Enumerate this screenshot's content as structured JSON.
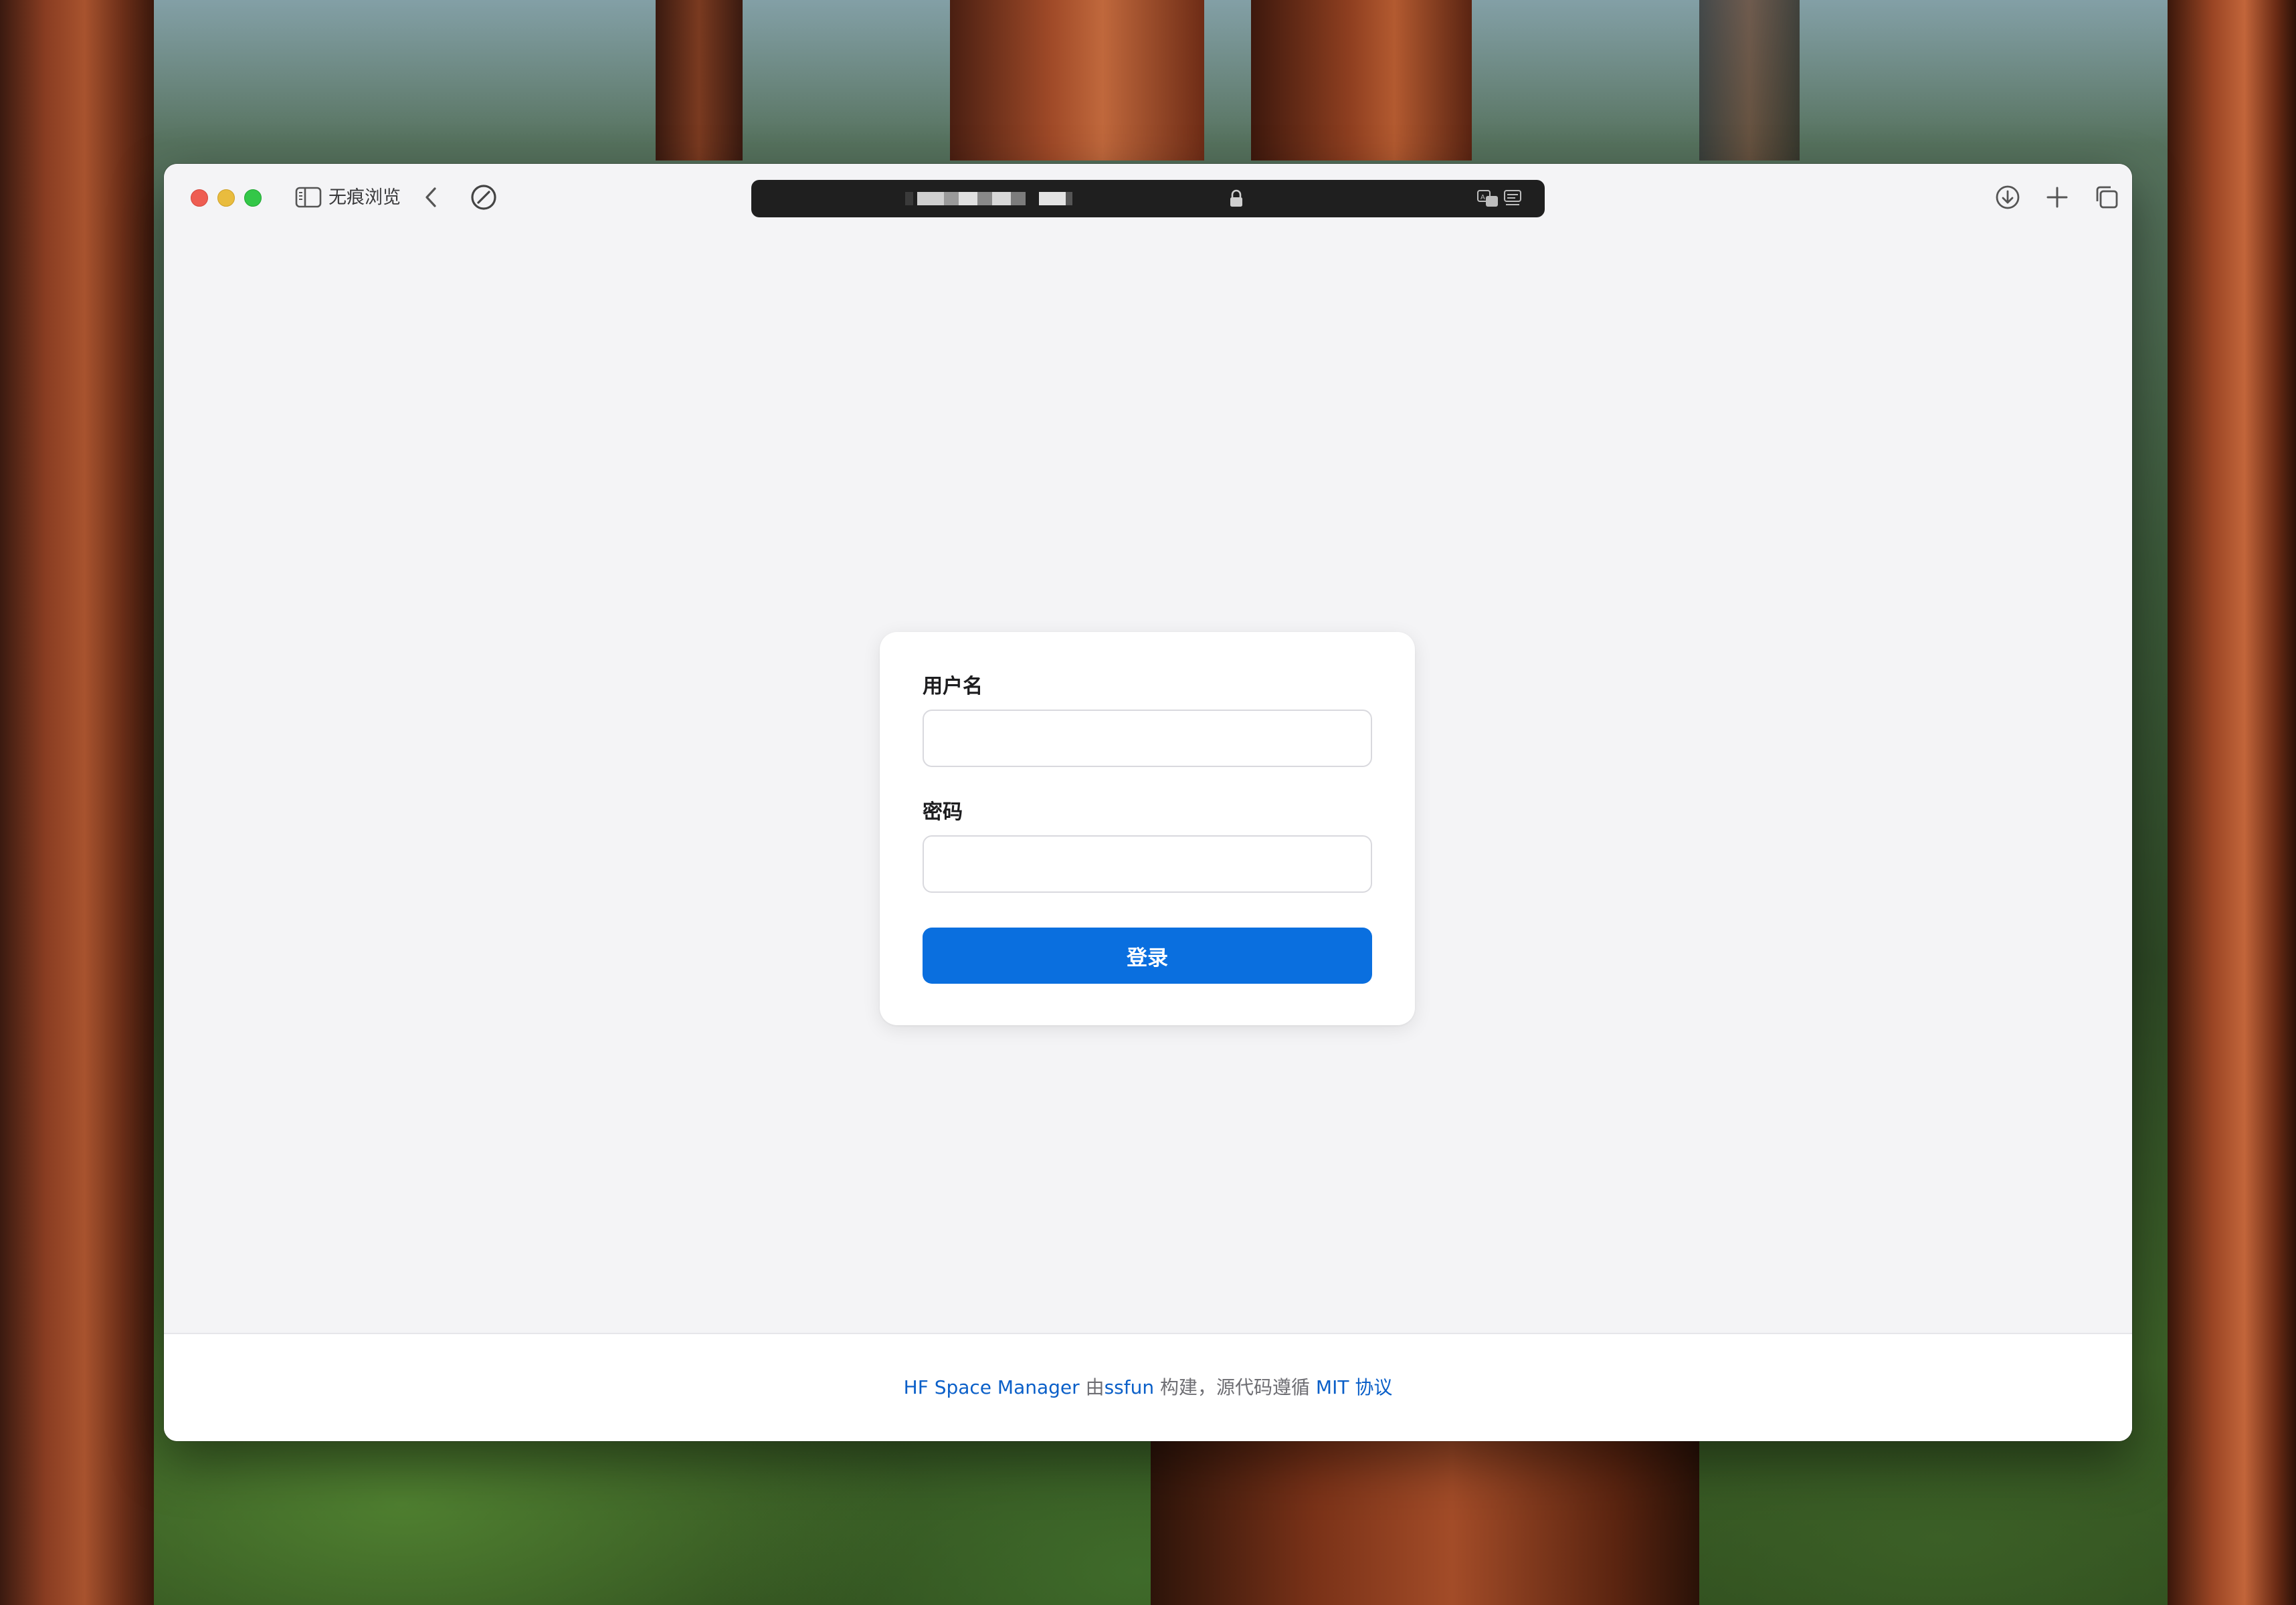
{
  "browser": {
    "private_label": "无痕浏览",
    "address_bar_colors": {
      "background": "#1f1f1f",
      "blurred_text": "#cfcfcf"
    }
  },
  "traffic_lights": {
    "close": "#ee5d52",
    "minimize": "#e9bc3e",
    "zoom": "#33c748"
  },
  "page": {
    "title": "HF Space Manager",
    "form": {
      "username_label": "用户名",
      "username_value": "",
      "password_label": "密码",
      "password_value": "",
      "submit_label": "登录",
      "submit_color": "#0a6fdf"
    },
    "footer": {
      "app_link": "HF Space Manager",
      "by_text": " 由",
      "author_link": "ssfun",
      "middle_text": " 构建，源代码遵循 ",
      "license_link": "MIT 协议",
      "link_color": "#0a5fc8"
    }
  },
  "icons": {
    "sidebar": "sidebar-icon",
    "back": "chevron-left-icon",
    "block": "no-entry-icon",
    "lock": "lock-icon",
    "translate": "translate-icon",
    "reader": "reader-icon",
    "download": "download-icon",
    "new_tab": "plus-icon",
    "tab_overview": "tabs-overview-icon"
  }
}
